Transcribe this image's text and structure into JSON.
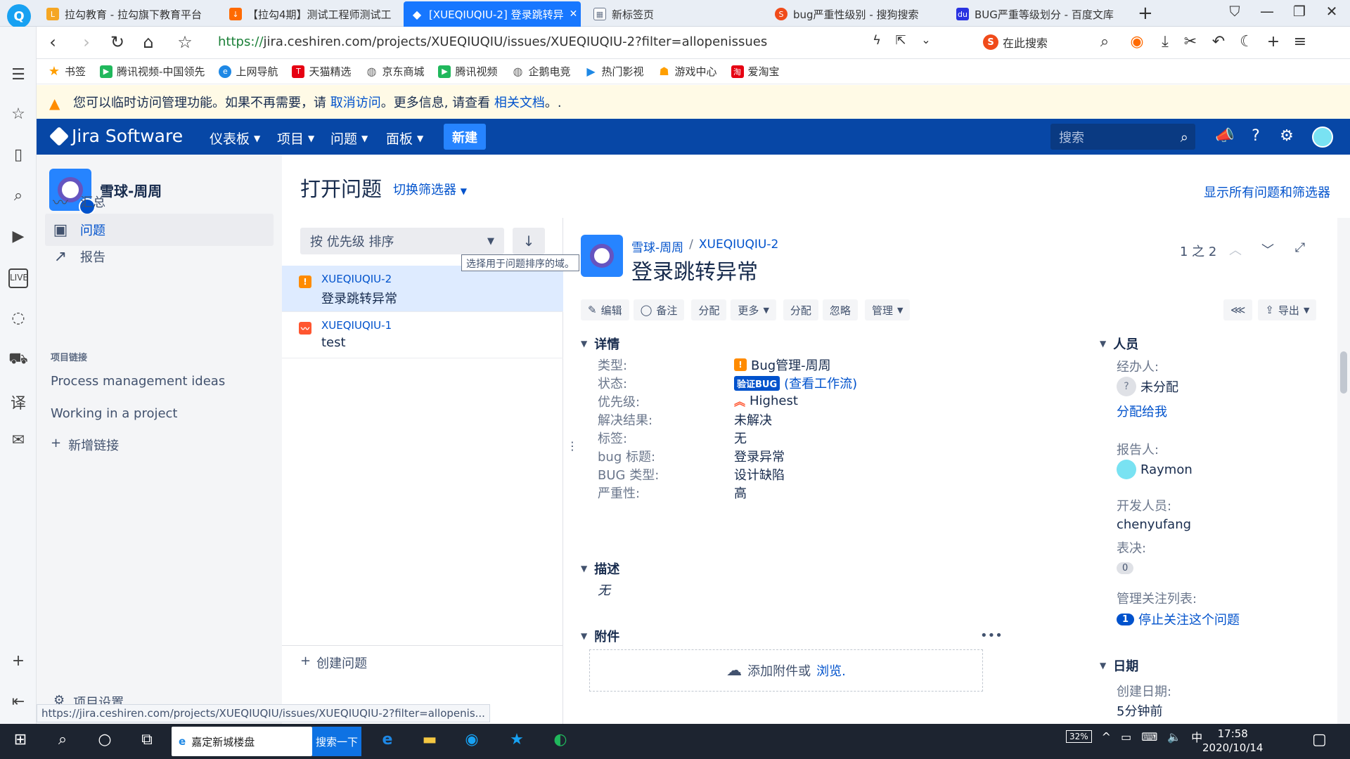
{
  "browser": {
    "tabs": [
      {
        "title": "拉勾教育 - 拉勾旗下教育平台",
        "icon": "lagou-icon",
        "color": "#f5a623"
      },
      {
        "title": "【拉勾4期】测试工程师测试工",
        "icon": "download-icon",
        "color": "#ff6a00"
      },
      {
        "title": "[XUEQIUQIU-2] 登录跳转异",
        "icon": "jira-icon",
        "color": "#ffffff",
        "active": true
      },
      {
        "title": "新标签页",
        "icon": "grid-icon",
        "color": "#6b778c"
      },
      {
        "title": "bug严重性级别 - 搜狗搜索",
        "icon": "sogou-icon",
        "color": "#f04b1a"
      },
      {
        "title": "BUG严重等级划分 - 百度文库",
        "icon": "baidu-icon",
        "color": "#2932e1"
      }
    ],
    "url_scheme": "https://",
    "url_rest": "jira.ceshiren.com/projects/XUEQIUQIU/issues/XUEQIUQIU-2?filter=allopenissues",
    "search_engine_placeholder": "在此搜索",
    "bookmarks": [
      "书签",
      "腾讯视频-中国领先",
      "上网导航",
      "天猫精选",
      "京东商城",
      "腾讯视频",
      "企鹅电竞",
      "热门影视",
      "游戏中心",
      "爱淘宝"
    ],
    "status_url": "https://jira.ceshiren.com/projects/XUEQIUQIU/issues/XUEQIUQIU-2?filter=allopenis..."
  },
  "banner": {
    "text1": "您可以临时访问管理功能。如果不再需要，请",
    "link1": "取消访问",
    "text2": "。更多信息, 请查看",
    "link2": "相关文档",
    "text3": "。."
  },
  "jira_nav": {
    "product": "Jira Software",
    "menus": [
      "仪表板",
      "项目",
      "问题",
      "面板"
    ],
    "create": "新建",
    "search_placeholder": "搜索"
  },
  "project": {
    "name": "雪球-周周",
    "nav": [
      {
        "label": "汇总",
        "icon": "pulse-icon"
      },
      {
        "label": "问题",
        "icon": "issues-icon",
        "active": true
      },
      {
        "label": "报告",
        "icon": "chart-icon"
      }
    ],
    "links_title": "项目链接",
    "links": [
      "Process management ideas",
      "Working in a project"
    ],
    "add_link": "新增链接",
    "settings": "项目设置"
  },
  "list": {
    "title": "打开问题",
    "switch_filter": "切换筛选器",
    "all_filters": "显示所有问题和筛选器",
    "sort_label": "按 优先级 排序",
    "tooltip": "选择用于问题排序的域。",
    "issues": [
      {
        "key": "XUEQIUQIU-2",
        "summary": "登录跳转异常",
        "type": "bug",
        "color": "#ff8b00",
        "selected": true
      },
      {
        "key": "XUEQIUQIU-1",
        "summary": "test",
        "type": "story",
        "color": "#ff5630"
      }
    ],
    "create_issue": "创建问题"
  },
  "issue": {
    "breadcrumb_project": "雪球-周周",
    "breadcrumb_key": "XUEQIUQIU-2",
    "title": "登录跳转异常",
    "pager": "1 之 2",
    "ops": [
      "编辑",
      "备注",
      "分配",
      "更多",
      "分配",
      "忽略",
      "管理"
    ],
    "export": "导出",
    "details_title": "详情",
    "fields": [
      {
        "label": "类型:",
        "value": "Bug管理-周周"
      },
      {
        "label": "状态:",
        "value": "验证BUG",
        "extra": "(查看工作流)"
      },
      {
        "label": "优先级:",
        "value": "Highest"
      },
      {
        "label": "解决结果:",
        "value": "未解决"
      },
      {
        "label": "标签:",
        "value": "无"
      },
      {
        "label": "bug 标题:",
        "value": "登录异常"
      },
      {
        "label": "BUG 类型:",
        "value": "设计缺陷"
      },
      {
        "label": "严重性:",
        "value": "高"
      }
    ],
    "description_title": "描述",
    "description_value": "无",
    "attachments_title": "附件",
    "attach_text": "添加附件或",
    "attach_link": "浏览.",
    "people_title": "人员",
    "assignee_label": "经办人:",
    "assignee_value": "未分配",
    "assign_to_me": "分配给我",
    "reporter_label": "报告人:",
    "reporter_value": "Raymon",
    "developer_label": "开发人员:",
    "developer_value": "chenyufang",
    "votes_label": "表决:",
    "votes_value": "0",
    "watchers_label": "管理关注列表:",
    "watchers_count": "1",
    "watchers_action": "停止关注这个问题",
    "dates_title": "日期",
    "created_label": "创建日期:",
    "created_value": "5分钟前"
  },
  "taskbar": {
    "search_text": "嘉定新城楼盘",
    "search_button": "搜索一下",
    "battery": "32%",
    "ime": "中",
    "time": "17:58",
    "date": "2020/10/14"
  }
}
